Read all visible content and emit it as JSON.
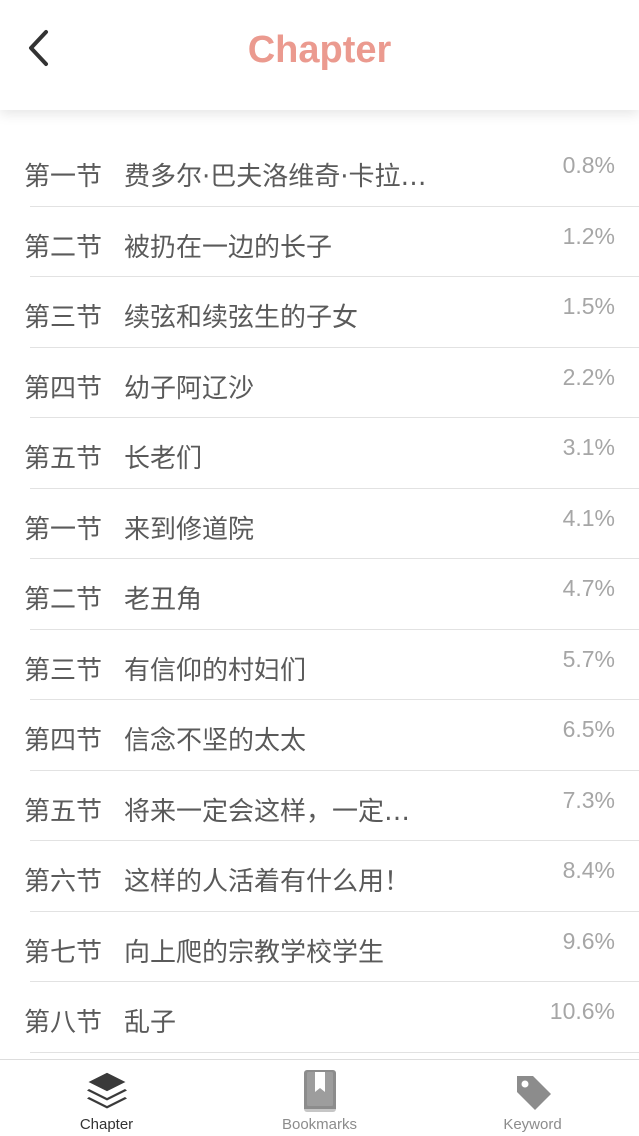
{
  "colors": {
    "accent": "#eb9a8f",
    "text": "#5a5a5a",
    "muted": "#a6a6a6",
    "active_tab": "#333333",
    "inactive_tab": "#8c8c8c"
  },
  "header": {
    "title": "Chapter",
    "back_icon": "chevron-left-icon"
  },
  "chapters": [
    {
      "section": "第一节",
      "title": "费多尔·巴夫洛维奇·卡拉…",
      "percent": "0.8%"
    },
    {
      "section": "第二节",
      "title": "被扔在一边的长子",
      "percent": "1.2%"
    },
    {
      "section": "第三节",
      "title": "续弦和续弦生的子女",
      "percent": "1.5%"
    },
    {
      "section": "第四节",
      "title": "幼子阿辽沙",
      "percent": "2.2%"
    },
    {
      "section": "第五节",
      "title": "长老们",
      "percent": "3.1%"
    },
    {
      "section": "第一节",
      "title": "来到修道院",
      "percent": "4.1%"
    },
    {
      "section": "第二节",
      "title": "老丑角",
      "percent": "4.7%"
    },
    {
      "section": "第三节",
      "title": "有信仰的村妇们",
      "percent": "5.7%"
    },
    {
      "section": "第四节",
      "title": "信念不坚的太太",
      "percent": "6.5%"
    },
    {
      "section": "第五节",
      "title": "将来一定会这样，一定…",
      "percent": "7.3%"
    },
    {
      "section": "第六节",
      "title": "这样的人活着有什么用！",
      "percent": "8.4%"
    },
    {
      "section": "第七节",
      "title": "向上爬的宗教学校学生",
      "percent": "9.6%"
    },
    {
      "section": "第八节",
      "title": "乱子",
      "percent": "10.6%"
    }
  ],
  "tabs": [
    {
      "label": "Chapter",
      "icon": "layers-icon",
      "active": true
    },
    {
      "label": "Bookmarks",
      "icon": "bookmark-book-icon",
      "active": false
    },
    {
      "label": "Keyword",
      "icon": "tag-icon",
      "active": false
    }
  ]
}
